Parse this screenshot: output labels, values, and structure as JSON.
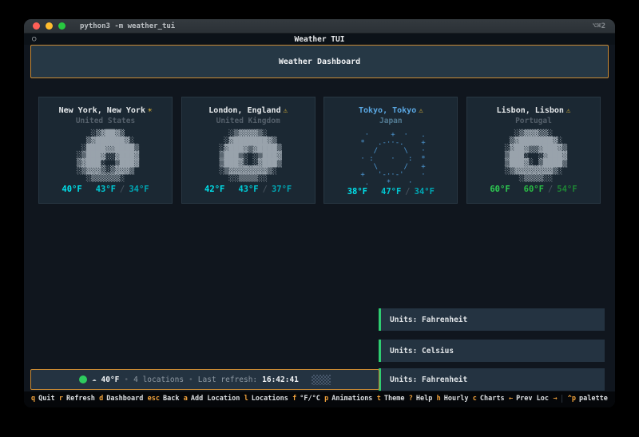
{
  "terminal": {
    "title": "python3 -m weather_tui",
    "shortcut": "⌥⌘2"
  },
  "app": {
    "header_icon": "○",
    "header_title": "Weather TUI",
    "dashboard_title": "Weather Dashboard",
    "temp_separator": "/"
  },
  "cards": [
    {
      "city": "New York, New York",
      "badge": "☀",
      "country": "United States",
      "art": "    ░▒▓██▓▒\n   ▒▓██████▓░\n  ░████▓▓████▒\n ░▒███▓░░▓███▓\n ▒▓███░  ▒███▓\n ░▒▓▓▓▒░▒▓▓▓▒\n   ░▒▒▒▒▒▒░",
      "temp_current": "40°F",
      "temp_high": "43°F",
      "temp_low": "34°F"
    },
    {
      "city": "London, England",
      "badge": "⚠",
      "country": "United Kingdom",
      "art": "   ░▒▓▓▓▓▒░\n  ░▓███████▓▒\n ░▓███▓▒▓████▒\n ▒███▒░ ░▒███▓\n ▒███▓░ ░▓███▒\n ░▒▓▓▓▓▓▓▓▓▒░\n   ░░▒▒▒▒░░",
      "temp_current": "42°F",
      "temp_high": "43°F",
      "temp_low": "37°F"
    },
    {
      "city": "Tokyo, Tokyo",
      "badge": "⚠",
      "country": "Japan",
      "art": "  ·     +  ·   .\n *   .-··-.    +\n    /      \\   ·\n · :    ·   :  *\n    \\      /   +\n +   '-··-'    ·\n  .    *    ·",
      "temp_current": "38°F",
      "temp_high": "47°F",
      "temp_low": "34°F"
    },
    {
      "city": "Lisbon, Lisbon",
      "badge": "⚠",
      "country": "Portugal",
      "art": "   ░▒▓▓▓▒▒░\n  ▒▓███████▓░\n ░▓██▓▒▒▓███▓▒\n ▒███░  ░▓███▓\n ▒███▓░ ▒████▒\n ░▒▓▓▓▓▓▓▓▓▒░\n    ░▒▒▒▒░░",
      "temp_current": "60°F",
      "temp_high": "60°F",
      "temp_low": "54°F"
    }
  ],
  "toasts": [
    {
      "text": "Units: Fahrenheit"
    },
    {
      "text": "Units: Celsius"
    },
    {
      "text": "Units: Fahrenheit"
    }
  ],
  "status_bar": {
    "indicator": "online",
    "weather_glyph": "☁",
    "temp": "40°F",
    "separator": "•",
    "locations": "4 locations",
    "refresh_label": "Last refresh:",
    "refresh_time": "16:42:41"
  },
  "footer": {
    "items": [
      {
        "key": "q",
        "label": "Quit"
      },
      {
        "key": "r",
        "label": "Refresh"
      },
      {
        "key": "d",
        "label": "Dashboard"
      },
      {
        "key": "esc",
        "label": "Back"
      },
      {
        "key": "a",
        "label": "Add Location"
      },
      {
        "key": "l",
        "label": "Locations"
      },
      {
        "key": "f",
        "label": "°F/°C"
      },
      {
        "key": "p",
        "label": "Animations"
      },
      {
        "key": "t",
        "label": "Theme"
      },
      {
        "key": "?",
        "label": "Help"
      },
      {
        "key": "h",
        "label": "Hourly"
      },
      {
        "key": "c",
        "label": "Charts"
      },
      {
        "key": "←",
        "label": "Prev Loc"
      },
      {
        "key": "→",
        "label": ""
      },
      {
        "key": "^p",
        "label": "palette",
        "divider_before": true
      }
    ]
  },
  "colors": {
    "accent_orange": "#c98a34",
    "cyan_bright": "#00e0ea",
    "cyan": "#00c9d4",
    "teal": "#00a7b4",
    "green_bright": "#2ecc52",
    "green": "#29b944",
    "green_dark": "#1e8634",
    "blue_title": "#5aa7e2",
    "badge_yellow": "#f5c63c",
    "toast_green": "#2ecc71",
    "status_dot_green": "#2ecc5e"
  }
}
